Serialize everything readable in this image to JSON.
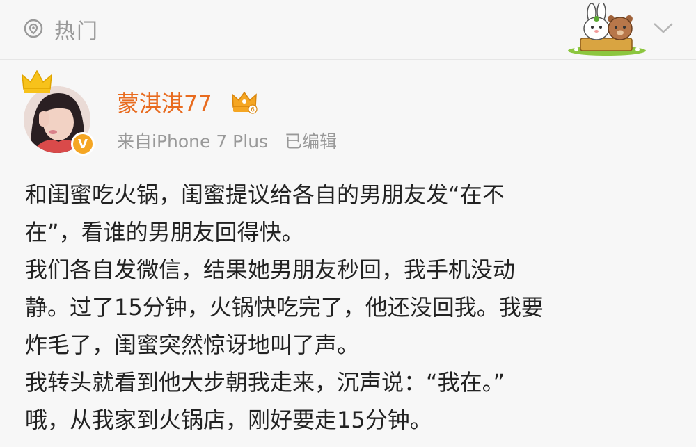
{
  "header": {
    "hot_label": "热门",
    "icons": {
      "hot": "location-pin-icon",
      "expand": "chevron-down-icon",
      "sticker": "bunny-bear-sticker"
    }
  },
  "post": {
    "username": "蒙淇淇77",
    "source": "来自iPhone 7 Plus",
    "edited": "已编辑",
    "verified_badge": "V",
    "colors": {
      "username": "#e86b1f",
      "badge": "#f5a623",
      "meta": "#999999"
    },
    "lines": [
      "和闺蜜吃火锅，闺蜜提议给各自的男朋友发“在不",
      "在”，看谁的男朋友回得快。",
      "我们各自发微信，结果她男朋友秒回，我手机没动",
      "静。过了15分钟，火锅快吃完了，他还没回我。我要",
      "炸毛了，闺蜜突然惊讶地叫了声。",
      "我转头就看到他大步朝我走来，沉声说：“我在。”",
      "哦，从我家到火锅店，刚好要走15分钟。"
    ]
  }
}
